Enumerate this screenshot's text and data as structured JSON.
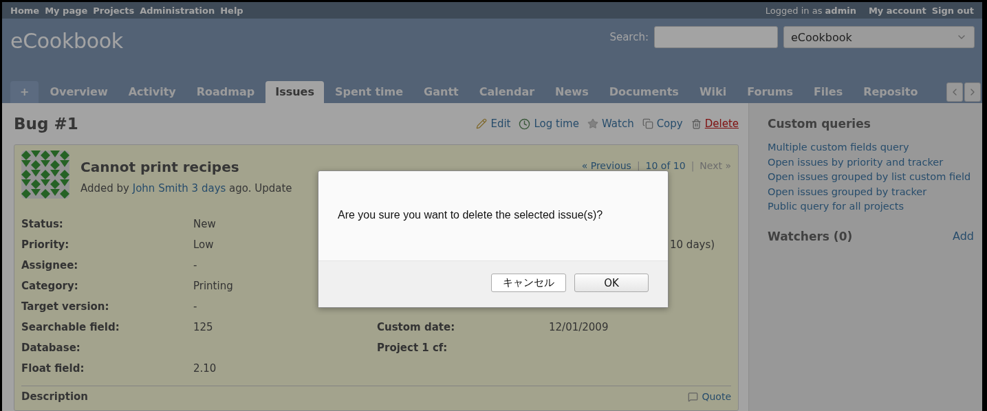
{
  "top_menu": {
    "items": [
      "Home",
      "My page",
      "Projects",
      "Administration",
      "Help"
    ],
    "logged_in": "Logged in as **admin**",
    "account": [
      "My account",
      "Sign out"
    ]
  },
  "header": {
    "title": "eCookbook",
    "search_label": "Search:",
    "project_select": "eCookbook"
  },
  "tabs": [
    {
      "label": "+",
      "kind": "new",
      "selected": false
    },
    {
      "label": "Overview",
      "kind": "tab",
      "selected": false
    },
    {
      "label": "Activity",
      "kind": "tab",
      "selected": false
    },
    {
      "label": "Roadmap",
      "kind": "tab",
      "selected": false
    },
    {
      "label": "Issues",
      "kind": "tab",
      "selected": true
    },
    {
      "label": "Spent time",
      "kind": "tab",
      "selected": false
    },
    {
      "label": "Gantt",
      "kind": "tab",
      "selected": false
    },
    {
      "label": "Calendar",
      "kind": "tab",
      "selected": false
    },
    {
      "label": "News",
      "kind": "tab",
      "selected": false
    },
    {
      "label": "Documents",
      "kind": "tab",
      "selected": false
    },
    {
      "label": "Wiki",
      "kind": "tab",
      "selected": false
    },
    {
      "label": "Forums",
      "kind": "tab",
      "selected": false
    },
    {
      "label": "Files",
      "kind": "tab",
      "selected": false
    },
    {
      "label": "Reposito",
      "kind": "tab",
      "selected": false
    }
  ],
  "issue": {
    "heading": "Bug #1",
    "actions": [
      {
        "label": "Edit",
        "kind": "edit"
      },
      {
        "label": "Log time",
        "kind": "log"
      },
      {
        "label": "Watch",
        "kind": "watch"
      },
      {
        "label": "Copy",
        "kind": "copy"
      },
      {
        "label": "Delete",
        "kind": "delete"
      }
    ],
    "subject": "Cannot print recipes",
    "byline": [
      {
        "text": "Added by",
        "kind": "text"
      },
      {
        "text": "John Smith",
        "kind": "link"
      },
      {
        "text": "3 days",
        "kind": "link"
      },
      {
        "text": "ago. Update",
        "kind": "text"
      }
    ],
    "pager": {
      "previous": "« Previous",
      "separator": "|",
      "position": "10 of 10",
      "next": "Next »",
      "next_disabled": true
    },
    "attributes_left": [
      {
        "label": "Status:",
        "value": "New"
      },
      {
        "label": "Priority:",
        "value": "Low"
      },
      {
        "label": "Assignee:",
        "value": "-"
      },
      {
        "label": "Category:",
        "value": "Printing"
      },
      {
        "label": "Target version:",
        "value": "-"
      },
      {
        "label": "Searchable field:",
        "value": "125"
      },
      {
        "label": "Database:"
      },
      {
        "label": "Float field:",
        "value": "2.10"
      }
    ],
    "attributes_right": [
      {
        "kind": "covered"
      },
      {
        "kind": "covered",
        "value": "10 days)"
      },
      {
        "kind": "covered"
      },
      {
        "kind": "covered"
      },
      {
        "kind": "covered"
      },
      {
        "label": "Custom date:",
        "kind": "text",
        "value": "12/01/2009"
      },
      {
        "label": "Project 1 cf:",
        "kind": "text"
      }
    ],
    "description_heading": "Description",
    "quote": "Quote"
  },
  "sidebar": {
    "heading": "Custom queries",
    "queries": [
      "Multiple custom fields query",
      "Open issues by priority and tracker",
      "Open issues grouped by list custom field",
      "Open issues grouped by tracker",
      "Public query for all projects"
    ],
    "watchers": "Watchers (0)",
    "add": "Add"
  },
  "dialog": {
    "message": "Are you sure you want to delete the selected issue(s)?",
    "buttons": [
      {
        "label": "キャンセル",
        "kind": "cancel"
      },
      {
        "label": "OK",
        "kind": "ok"
      }
    ]
  }
}
